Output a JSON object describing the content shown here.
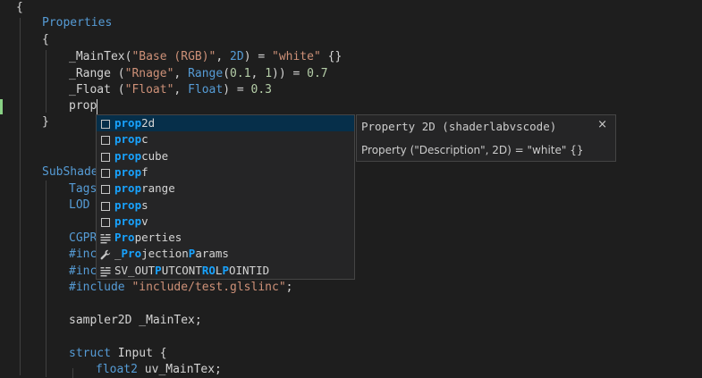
{
  "code": {
    "l1": "{",
    "l2_kw": "Properties",
    "l3": "{",
    "l4": [
      {
        "t": "_MainTex(",
        "c": "plain"
      },
      {
        "t": "\"Base (RGB)\"",
        "c": "str"
      },
      {
        "t": ", ",
        "c": "plain"
      },
      {
        "t": "2D",
        "c": "kw"
      },
      {
        "t": ") = ",
        "c": "plain"
      },
      {
        "t": "\"white\"",
        "c": "str"
      },
      {
        "t": " {}",
        "c": "plain"
      }
    ],
    "l5": [
      {
        "t": "_Range (",
        "c": "plain"
      },
      {
        "t": "\"Rnage\"",
        "c": "str"
      },
      {
        "t": ", ",
        "c": "plain"
      },
      {
        "t": "Range",
        "c": "kw"
      },
      {
        "t": "(",
        "c": "plain"
      },
      {
        "t": "0.1",
        "c": "num"
      },
      {
        "t": ", ",
        "c": "plain"
      },
      {
        "t": "1",
        "c": "num"
      },
      {
        "t": ")) = ",
        "c": "plain"
      },
      {
        "t": "0.7",
        "c": "num"
      }
    ],
    "l6": [
      {
        "t": "_Float (",
        "c": "plain"
      },
      {
        "t": "\"Float\"",
        "c": "str"
      },
      {
        "t": ", ",
        "c": "plain"
      },
      {
        "t": "Float",
        "c": "kw"
      },
      {
        "t": ") = ",
        "c": "plain"
      },
      {
        "t": "0.3",
        "c": "num"
      }
    ],
    "l7": "prop",
    "l8": "}",
    "l10_kw": "SubShade",
    "l11_kw": "Tags",
    "l12_kw": "LOD",
    "l14_kw": "CGPR",
    "l15_kw": "#inc",
    "l16_kw": "#inc",
    "l17_kw": "#include",
    "l17_str": "\"include/test.glslinc\"",
    "l17_end": ";",
    "l19": "sampler2D _MainTex;",
    "l21_kw": "struct",
    "l21_rest": " Input {",
    "l22_kw": "float2",
    "l22_rest": " uv_MainTex;"
  },
  "suggest": {
    "items": [
      {
        "icon": "snippet-icon",
        "parts": [
          [
            "prop",
            1
          ],
          [
            "2d",
            0
          ]
        ],
        "selected": true
      },
      {
        "icon": "snippet-icon",
        "parts": [
          [
            "prop",
            1
          ],
          [
            "c",
            0
          ]
        ]
      },
      {
        "icon": "snippet-icon",
        "parts": [
          [
            "prop",
            1
          ],
          [
            "cube",
            0
          ]
        ]
      },
      {
        "icon": "snippet-icon",
        "parts": [
          [
            "prop",
            1
          ],
          [
            "f",
            0
          ]
        ]
      },
      {
        "icon": "snippet-icon",
        "parts": [
          [
            "prop",
            1
          ],
          [
            "range",
            0
          ]
        ]
      },
      {
        "icon": "snippet-icon",
        "parts": [
          [
            "prop",
            1
          ],
          [
            "s",
            0
          ]
        ]
      },
      {
        "icon": "snippet-icon",
        "parts": [
          [
            "prop",
            1
          ],
          [
            "v",
            0
          ]
        ]
      },
      {
        "icon": "keyword-icon",
        "parts": [
          [
            "Pro",
            1
          ],
          [
            "perties",
            0
          ]
        ]
      },
      {
        "icon": "wrench-icon",
        "parts": [
          [
            "_",
            0
          ],
          [
            "Pro",
            1
          ],
          [
            "jection",
            0
          ],
          [
            "P",
            1
          ],
          [
            "arams",
            0
          ]
        ]
      },
      {
        "icon": "keyword-icon",
        "parts": [
          [
            "SV_OUT",
            0
          ],
          [
            "P",
            1
          ],
          [
            "UTCONT",
            0
          ],
          [
            "RO",
            1
          ],
          [
            "L",
            0
          ],
          [
            "P",
            1
          ],
          [
            "OINTID",
            0
          ]
        ]
      }
    ]
  },
  "details": {
    "title": "Property 2D (shaderlabvscode)",
    "close": "×",
    "doc": "Property (\"Description\", 2D) = \"white\" {}"
  },
  "colors": {
    "background": "#1e1e1e",
    "keyword": "#569cd6",
    "string": "#ce9178",
    "number": "#b5cea8",
    "match_highlight": "#18a3ff",
    "selection": "#062f4a"
  }
}
